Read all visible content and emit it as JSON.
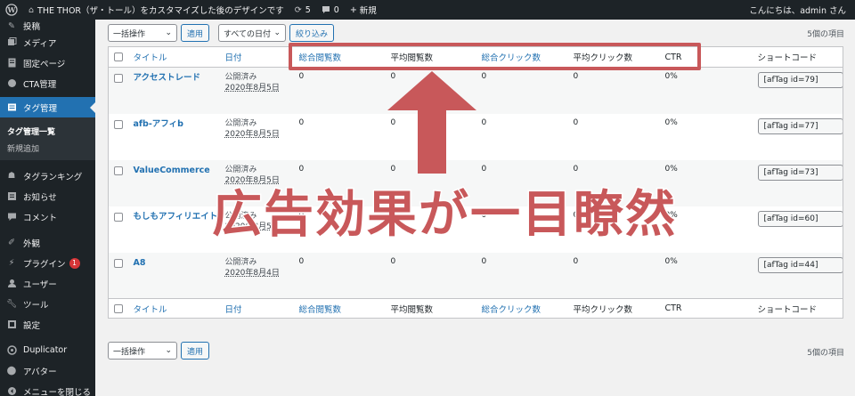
{
  "adminbar": {
    "site_name": "THE THOR（ザ・トール）をカスタマイズした後のデザインです",
    "updates_count": "5",
    "comments_count": "0",
    "new_label": "新規",
    "greeting": "こんにちは、admin さん"
  },
  "sidebar": {
    "items_top": [
      {
        "label": "投稿",
        "icon": "pin-icon"
      },
      {
        "label": "メディア",
        "icon": "media-icon"
      },
      {
        "label": "固定ページ",
        "icon": "page-icon"
      },
      {
        "label": "CTA管理",
        "icon": "cta-icon"
      }
    ],
    "current": {
      "label": "タグ管理",
      "icon": "tag-icon"
    },
    "submenu": [
      {
        "label": "タグ管理一覧"
      },
      {
        "label": "新規追加"
      }
    ],
    "items_bottom": [
      {
        "label": "タグランキング",
        "icon": "ranking-icon"
      },
      {
        "label": "お知らせ",
        "icon": "notice-icon"
      },
      {
        "label": "コメント",
        "icon": "comment-icon"
      },
      {
        "label": "外観",
        "icon": "appearance-icon"
      },
      {
        "label": "プラグイン",
        "icon": "plugin-icon",
        "badge": "1"
      },
      {
        "label": "ユーザー",
        "icon": "user-icon"
      },
      {
        "label": "ツール",
        "icon": "tool-icon"
      },
      {
        "label": "設定",
        "icon": "settings-icon"
      },
      {
        "label": "Duplicator",
        "icon": "duplicator-icon"
      },
      {
        "label": "アバター",
        "icon": "avatar-icon"
      },
      {
        "label": "メニューを閉じる",
        "icon": "collapse-icon"
      }
    ]
  },
  "tablenav": {
    "bulk_action": "一括操作",
    "apply": "適用",
    "date_filter": "すべての日付",
    "filter": "絞り込み",
    "count": "5個の項目"
  },
  "table": {
    "columns": [
      "タイトル",
      "日付",
      "総合閲覧数",
      "平均閲覧数",
      "総合クリック数",
      "平均クリック数",
      "CTR",
      "ショートコード"
    ],
    "rows": [
      {
        "title": "アクセストレード",
        "status": "公開済み",
        "date": "2020年8月5日",
        "total_views": "0",
        "avg_views": "0",
        "total_clicks": "0",
        "avg_clicks": "0",
        "ctr": "0%",
        "shortcode": "[afTag id=79]"
      },
      {
        "title": "afb-アフィb",
        "status": "公開済み",
        "date": "2020年8月5日",
        "total_views": "0",
        "avg_views": "0",
        "total_clicks": "0",
        "avg_clicks": "0",
        "ctr": "0%",
        "shortcode": "[afTag id=77]"
      },
      {
        "title": "ValueCommerce",
        "status": "公開済み",
        "date": "2020年8月5日",
        "total_views": "0",
        "avg_views": "0",
        "total_clicks": "0",
        "avg_clicks": "0",
        "ctr": "0%",
        "shortcode": "[afTag id=73]"
      },
      {
        "title": "もしもアフィリエイト",
        "status": "公開済み",
        "date": "2020年8月5日",
        "total_views": "0",
        "avg_views": "0",
        "total_clicks": "0",
        "avg_clicks": "0",
        "ctr": "0%",
        "shortcode": "[afTag id=60]"
      },
      {
        "title": "A8",
        "status": "公開済み",
        "date": "2020年8月4日",
        "total_views": "0",
        "avg_views": "0",
        "total_clicks": "0",
        "avg_clicks": "0",
        "ctr": "0%",
        "shortcode": "[afTag id=44]"
      }
    ]
  },
  "overlay": {
    "caption": "広告効果が一目瞭然",
    "color": "#c8585a"
  }
}
